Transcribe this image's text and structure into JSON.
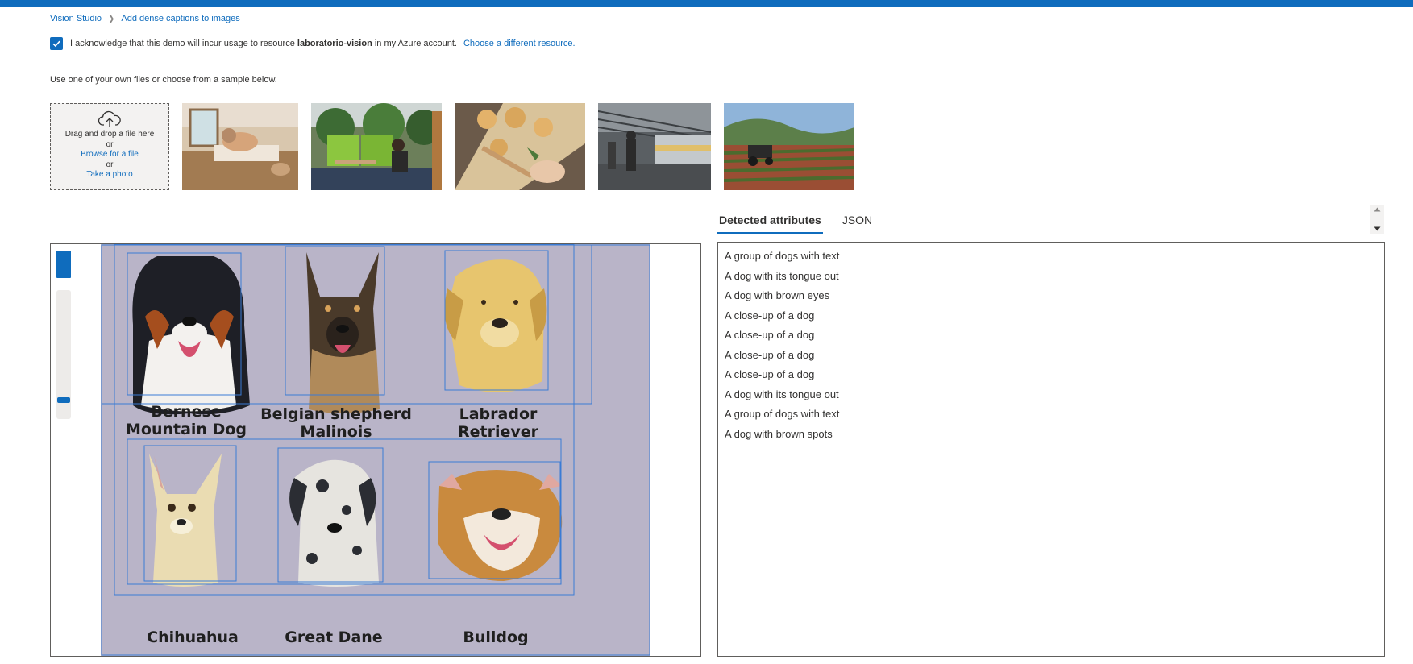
{
  "breadcrumb": {
    "home": "Vision Studio",
    "current": "Add dense captions to images"
  },
  "acknowledge": {
    "checked": true,
    "text_before": "I acknowledge that this demo will incur usage to resource",
    "resource": "laboratorio-vision",
    "text_after": "in my Azure account.",
    "change_link": "Choose a different resource."
  },
  "instruction": "Use one of your own files or choose from a sample below.",
  "upload": {
    "icon": "cloud-upload-icon",
    "drag_text": "Drag and drop a file here",
    "or1": "or",
    "browse_link": "Browse for a file",
    "or2": "or",
    "photo_link": "Take a photo"
  },
  "tabs": {
    "active": "Detected attributes",
    "other": "JSON"
  },
  "captions": [
    "A group of dogs with text",
    "A dog with its tongue out",
    "A dog with brown eyes",
    "A close-up of a dog",
    "A close-up of a dog",
    "A close-up of a dog",
    "A close-up of a dog",
    "A dog with its tongue out",
    "A group of dogs with text",
    "A dog with brown spots"
  ],
  "image_labels": {
    "bernese_1": "Bernese",
    "bernese_2": "Mountain Dog",
    "belgian_1": "Belgian shepherd",
    "belgian_2": "Malinois",
    "labrador_1": "Labrador",
    "labrador_2": "Retriever",
    "chihuahua": "Chihuahua",
    "great_dane": "Great Dane",
    "bulldog": "Bulldog"
  },
  "colors": {
    "accent": "#0f6cbd",
    "image_bg": "#b9b4c8",
    "box_stroke": "#3a7bd5"
  }
}
